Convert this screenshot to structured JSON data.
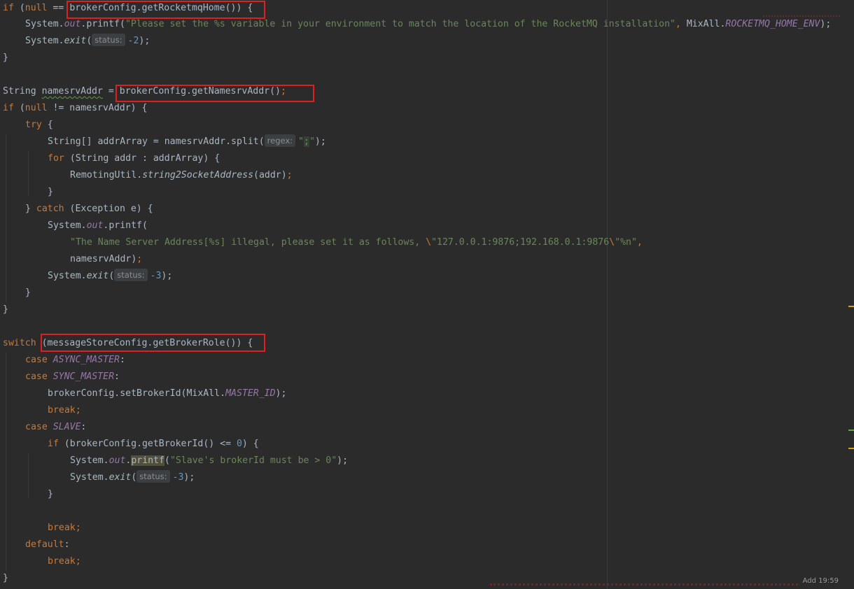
{
  "editor": {
    "hints": {
      "status": "status:",
      "regex": "regex:"
    },
    "code": {
      "l1": {
        "kw_if": "if",
        "open": " (",
        "kw_null": "null",
        "op": " == ",
        "call": "brokerConfig.getRocketmqHome()) {"
      },
      "l2": {
        "a": "System.",
        "out": "out",
        "b": ".printf(",
        "str": "\"Please set the %s variable in your environment to match the location of the RocketMQ installation\"",
        "comma": ", ",
        "cls": "MixAll.",
        "field": "ROCKETMQ_HOME_ENV",
        "end": ");"
      },
      "l3": {
        "a": "System.",
        "exit": "exit",
        "b": "(",
        "num": "-2",
        "end": ");"
      },
      "l4": "}",
      "l6": {
        "type": "String ",
        "var": "namesrvAddr",
        "eq": " = ",
        "call": "brokerConfig.getNamesrvAddr()",
        "semi": ";"
      },
      "l7": {
        "kw_if": "if",
        "open": " (",
        "kw_null": "null",
        "rest": " != namesrvAddr) {"
      },
      "l8": "try",
      "l8b": " {",
      "l9": {
        "a": "String[] addrArray = namesrvAddr.split(",
        "q1": "\"",
        "semi": ";",
        "q2": "\"",
        "end": ");"
      },
      "l10": {
        "kw_for": "for",
        "rest": " (String addr : addrArray) {"
      },
      "l11": {
        "a": "RemotingUtil.",
        "m": "string2SocketAddress",
        "b": "(addr)",
        "end": ";"
      },
      "l12": "}",
      "l13": {
        "a": "} ",
        "kw_catch": "catch",
        "b": " (Exception e) {"
      },
      "l14": {
        "a": "System.",
        "out": "out",
        "b": ".printf("
      },
      "l15": {
        "s1": "\"The Name Server Address[%s] illegal, please set it as follows, ",
        "e1": "\\",
        "s2": "\"127.0.0.1:9876;192.168.0.1:9876",
        "e2": "\\",
        "s3": "\"%n\"",
        "comma": ","
      },
      "l16": {
        "a": "namesrvAddr)",
        "end": ";"
      },
      "l17": {
        "a": "System.",
        "exit": "exit",
        "b": "(",
        "num": "-3",
        "end": ");"
      },
      "l18": "}",
      "l19": "}",
      "l21": {
        "kw_switch": "switch",
        "rest": " (messageStoreConfig.getBrokerRole()) {"
      },
      "l22": {
        "kw_case": "case ",
        "field": "ASYNC_MASTER",
        "colon": ":"
      },
      "l23": {
        "kw_case": "case ",
        "field": "SYNC_MASTER",
        "colon": ":"
      },
      "l24": {
        "a": "brokerConfig.setBrokerId(MixAll.",
        "field": "MASTER_ID",
        "end": ");"
      },
      "l25": "break;",
      "l26": {
        "kw_case": "case ",
        "field": "SLAVE",
        "colon": ":"
      },
      "l27": {
        "kw_if": "if",
        "a": " (brokerConfig.getBrokerId() <= ",
        "num": "0",
        "end": ") {"
      },
      "l28": {
        "a": "System.",
        "out": "out",
        "dot": ".",
        "printf": "printf",
        "b": "(",
        "str": "\"Slave's brokerId must be > 0\"",
        "end": ");"
      },
      "l29": {
        "a": "System.",
        "exit": "exit",
        "b": "(",
        "num": "-3",
        "end": ");"
      },
      "l30": "}",
      "l32": "break;",
      "l33": {
        "kw_default": "default",
        "colon": ":"
      },
      "l34": "break;",
      "l35": "}"
    },
    "corner_text": "Add 19:59"
  },
  "colors": {
    "background": "#2b2b2b",
    "keyword": "#cc7832",
    "string": "#6a8759",
    "number": "#6897bb",
    "field": "#9876aa",
    "text": "#a9b7c6",
    "annotation_box": "#e02020"
  }
}
